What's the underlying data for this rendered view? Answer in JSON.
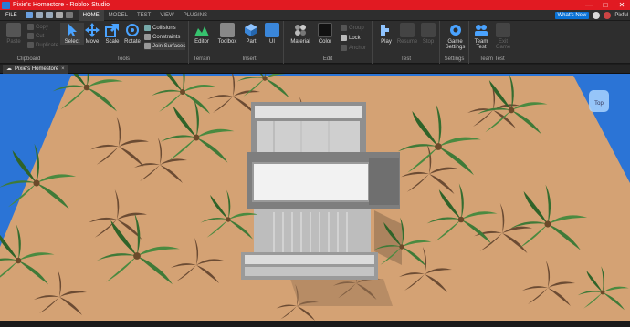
{
  "window": {
    "title": "Pixie's Homestore - Roblox Studio",
    "buttons": [
      "—",
      "□",
      "✕"
    ]
  },
  "menubar": {
    "file": "FILE",
    "tabs": [
      "HOME",
      "MODEL",
      "TEST",
      "VIEW",
      "PLUGINS"
    ],
    "active_tab": "HOME",
    "whats_new": "What's New",
    "username": "Pixful"
  },
  "ribbon": {
    "clipboard": {
      "label": "Clipboard",
      "paste": "Paste",
      "copy": "Copy",
      "cut": "Cut",
      "duplicate": "Duplicate"
    },
    "tools": {
      "label": "Tools",
      "select": "Select",
      "move": "Move",
      "scale": "Scale",
      "rotate": "Rotate",
      "collisions": "Collisions",
      "constraints": "Constraints",
      "join_surfaces": "Join Surfaces"
    },
    "terrain": {
      "label": "Terrain",
      "editor": "Editor"
    },
    "insert": {
      "label": "Insert",
      "toolbox": "Toolbox",
      "part": "Part",
      "ui": "UI"
    },
    "edit": {
      "label": "Edit",
      "material": "Material",
      "color": "Color",
      "group": "Group",
      "lock": "Lock",
      "anchor": "Anchor"
    },
    "test": {
      "label": "Test",
      "play": "Play",
      "resume": "Resume",
      "stop": "Stop"
    },
    "settings": {
      "label": "Settings",
      "game_settings": "Game Settings"
    },
    "team_test": {
      "label": "Team Test",
      "team_test": "Team Test",
      "exit_game": "Exit Game"
    }
  },
  "doc_tab": {
    "label": "Pixie's Homestore",
    "close": "×"
  },
  "viewport": {
    "view_cube_label": "Top"
  },
  "colors": {
    "titlebar": "#e11a22",
    "sky": "#2b74d6",
    "sand": "#d4a274",
    "palm_leaf": "#3f7a38",
    "building": "#d8d8d8"
  }
}
